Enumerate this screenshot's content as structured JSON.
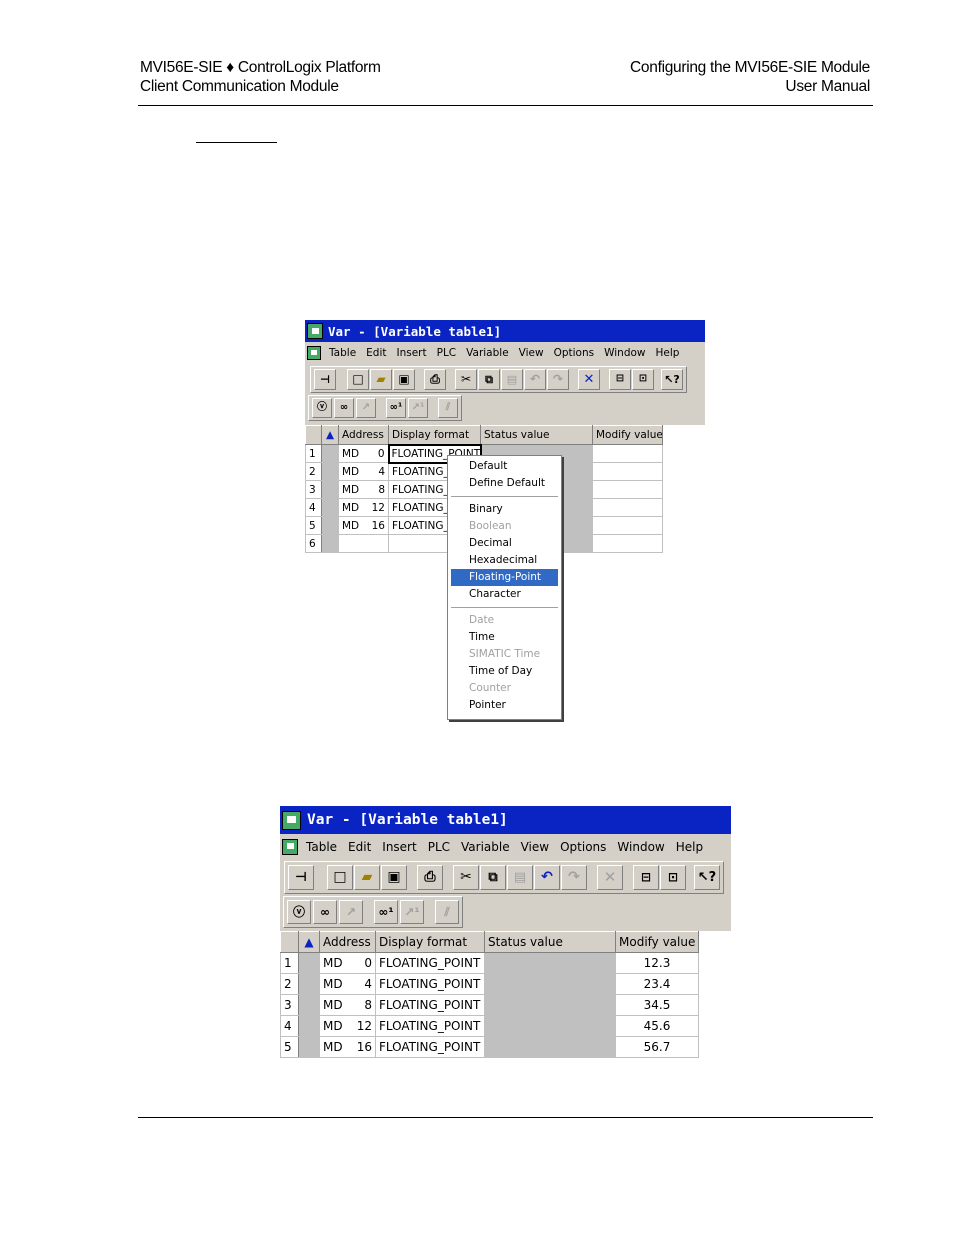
{
  "header": {
    "left_line1": "MVI56E-SIE ♦ ControlLogix Platform",
    "left_line2": "Client Communication Module",
    "right_line1": "Configuring the MVI56E-SIE Module",
    "right_line2": "User Manual"
  },
  "window": {
    "title": "Var - [Variable table1]",
    "menu": [
      "Table",
      "Edit",
      "Insert",
      "PLC",
      "Variable",
      "View",
      "Options",
      "Window",
      "Help"
    ],
    "columns": [
      "Address",
      "Display format",
      "Status value",
      "Modify value"
    ]
  },
  "toolbar_icons": [
    "pin-icon",
    "new-icon",
    "open-icon",
    "save-icon",
    "print-icon",
    "cut-icon",
    "copy-icon",
    "paste-icon",
    "undo-icon",
    "redo-icon",
    "delete-icon",
    "online-icon",
    "connection-icon",
    "help-pointer-icon"
  ],
  "toolbar2_icons": [
    "monitor-icon",
    "modify-icon",
    "trigger-icon",
    "monitor-once-icon",
    "modify-once-icon",
    "force-icon"
  ],
  "table1": {
    "rows": [
      {
        "n": "1",
        "area": "MD",
        "addr": "0",
        "format": "FLOATING_POINT"
      },
      {
        "n": "2",
        "area": "MD",
        "addr": "4",
        "format": "FLOATING_"
      },
      {
        "n": "3",
        "area": "MD",
        "addr": "8",
        "format": "FLOATING_"
      },
      {
        "n": "4",
        "area": "MD",
        "addr": "12",
        "format": "FLOATING_"
      },
      {
        "n": "5",
        "area": "MD",
        "addr": "16",
        "format": "FLOATING_"
      },
      {
        "n": "6",
        "area": "",
        "addr": "",
        "format": ""
      }
    ]
  },
  "context_menu": {
    "group1": [
      "Default",
      "Define Default"
    ],
    "group2": [
      "Binary",
      "Boolean",
      "Decimal",
      "Hexadecimal",
      "Floating-Point",
      "Character"
    ],
    "group3": [
      "Date",
      "Time",
      "SIMATIC Time",
      "Time of Day",
      "Counter",
      "Pointer"
    ],
    "disabled": [
      "Boolean",
      "Date",
      "SIMATIC Time",
      "Counter"
    ],
    "highlighted": "Floating-Point"
  },
  "table2": {
    "rows": [
      {
        "n": "1",
        "area": "MD",
        "addr": "0",
        "format": "FLOATING_POINT",
        "modify": "12.3"
      },
      {
        "n": "2",
        "area": "MD",
        "addr": "4",
        "format": "FLOATING_POINT",
        "modify": "23.4"
      },
      {
        "n": "3",
        "area": "MD",
        "addr": "8",
        "format": "FLOATING_POINT",
        "modify": "34.5"
      },
      {
        "n": "4",
        "area": "MD",
        "addr": "12",
        "format": "FLOATING_POINT",
        "modify": "45.6"
      },
      {
        "n": "5",
        "area": "MD",
        "addr": "16",
        "format": "FLOATING_POINT",
        "modify": "56.7"
      }
    ]
  }
}
